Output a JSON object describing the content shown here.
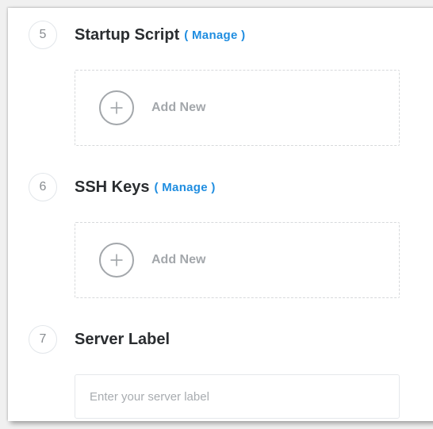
{
  "sections": {
    "startup": {
      "step": "5",
      "title": "Startup Script",
      "manage": "( Manage )",
      "add_label": "Add New"
    },
    "ssh": {
      "step": "6",
      "title": "SSH Keys",
      "manage": "( Manage )",
      "add_label": "Add New"
    },
    "label": {
      "step": "7",
      "title": "Server Label",
      "placeholder": "Enter your server label",
      "value": ""
    }
  }
}
